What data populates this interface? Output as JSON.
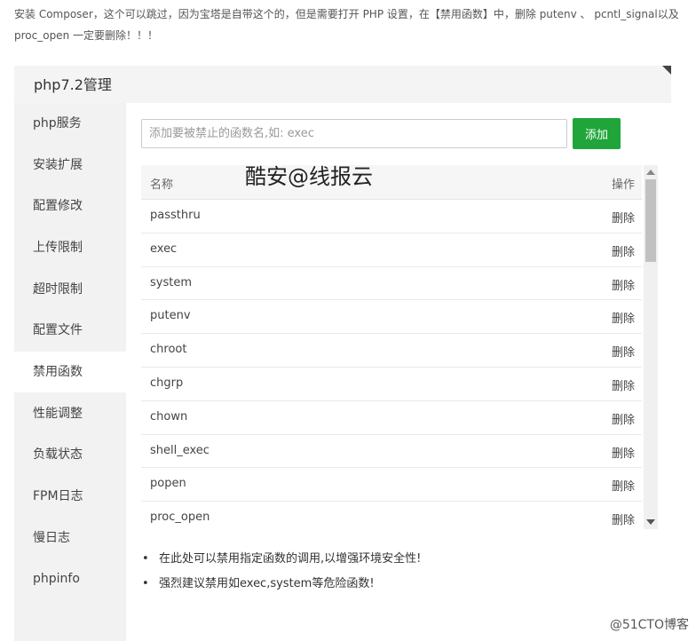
{
  "intro": {
    "text": "安装 Composer，这个可以跳过，因为宝塔是自带这个的，但是需要打开 PHP 设置，在【禁用函数】中，删除 putenv 、 pcntl_signal以及 proc_open 一定要删除！！！"
  },
  "panel": {
    "title": "php7.2管理"
  },
  "sidebar": {
    "items": [
      {
        "label": "php服务"
      },
      {
        "label": "安装扩展"
      },
      {
        "label": "配置修改"
      },
      {
        "label": "上传限制"
      },
      {
        "label": "超时限制"
      },
      {
        "label": "配置文件"
      },
      {
        "label": "禁用函数",
        "active": true
      },
      {
        "label": "性能调整"
      },
      {
        "label": "负载状态"
      },
      {
        "label": "FPM日志"
      },
      {
        "label": "慢日志"
      },
      {
        "label": "phpinfo"
      }
    ]
  },
  "search": {
    "placeholder": "添加要被禁止的函数名,如: exec",
    "value": ""
  },
  "add_button": {
    "label": "添加"
  },
  "table": {
    "headers": {
      "name": "名称",
      "op": "操作"
    },
    "rows": [
      {
        "name": "passthru",
        "action": "删除"
      },
      {
        "name": "exec",
        "action": "删除"
      },
      {
        "name": "system",
        "action": "删除"
      },
      {
        "name": "putenv",
        "action": "删除"
      },
      {
        "name": "chroot",
        "action": "删除"
      },
      {
        "name": "chgrp",
        "action": "删除"
      },
      {
        "name": "chown",
        "action": "删除"
      },
      {
        "name": "shell_exec",
        "action": "删除"
      },
      {
        "name": "popen",
        "action": "删除"
      },
      {
        "name": "proc_open",
        "action": "删除"
      }
    ]
  },
  "overlay_text": "酷安@线报云",
  "tips": [
    "在此处可以禁用指定函数的调用,以增强环境安全性!",
    "强烈建议禁用如exec,system等危险函数!"
  ],
  "watermark": "@51CTO博客",
  "colors": {
    "accent": "#20a53a",
    "sidebar_bg": "#f2f2f2",
    "header_bg": "#f4f4f4"
  }
}
